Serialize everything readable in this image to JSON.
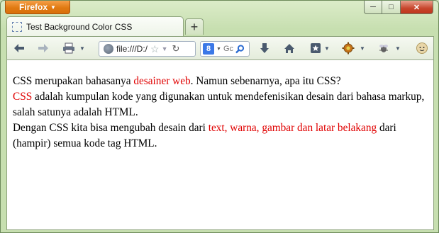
{
  "app": {
    "menu_label": "Firefox",
    "menu_arrow": "▼"
  },
  "window_controls": {
    "minimize": "─",
    "maximize": "□",
    "close": "✕"
  },
  "tab": {
    "title": "Test Background Color CSS",
    "new_tab_label": "+"
  },
  "navbar": {
    "url": "file:///D:/",
    "search_placeholder": "Gc",
    "icons": [
      "back-icon",
      "forward-icon",
      "print-icon",
      "dropdown-icon",
      "globe-icon",
      "bookmark-star-icon",
      "reload-icon",
      "google-search-icon",
      "magnifier-icon",
      "download-icon",
      "home-icon",
      "bookmarks-icon",
      "addon-gear-icon",
      "addon-bug-icon",
      "avatar-icon"
    ]
  },
  "content": {
    "line1_a": "CSS merupakan bahasanya ",
    "line1_red": "desainer web",
    "line1_b": ". Namun sebenarnya, apa itu CSS?",
    "line2_red": "CSS",
    "line2_b": " adalah kumpulan kode yang digunakan untuk mendefenisikan desain dari bahasa markup, salah satunya adalah HTML.",
    "line3_a": "Dengan CSS kita bisa mengubah desain dari ",
    "line3_red": "text, warna, gambar dan latar belakang",
    "line3_b": " dari (hampir) semua kode tag HTML."
  },
  "colors": {
    "accent_red": "#e00000",
    "firefox_orange": "#e07a12",
    "chrome_green": "#c7dfb0"
  }
}
